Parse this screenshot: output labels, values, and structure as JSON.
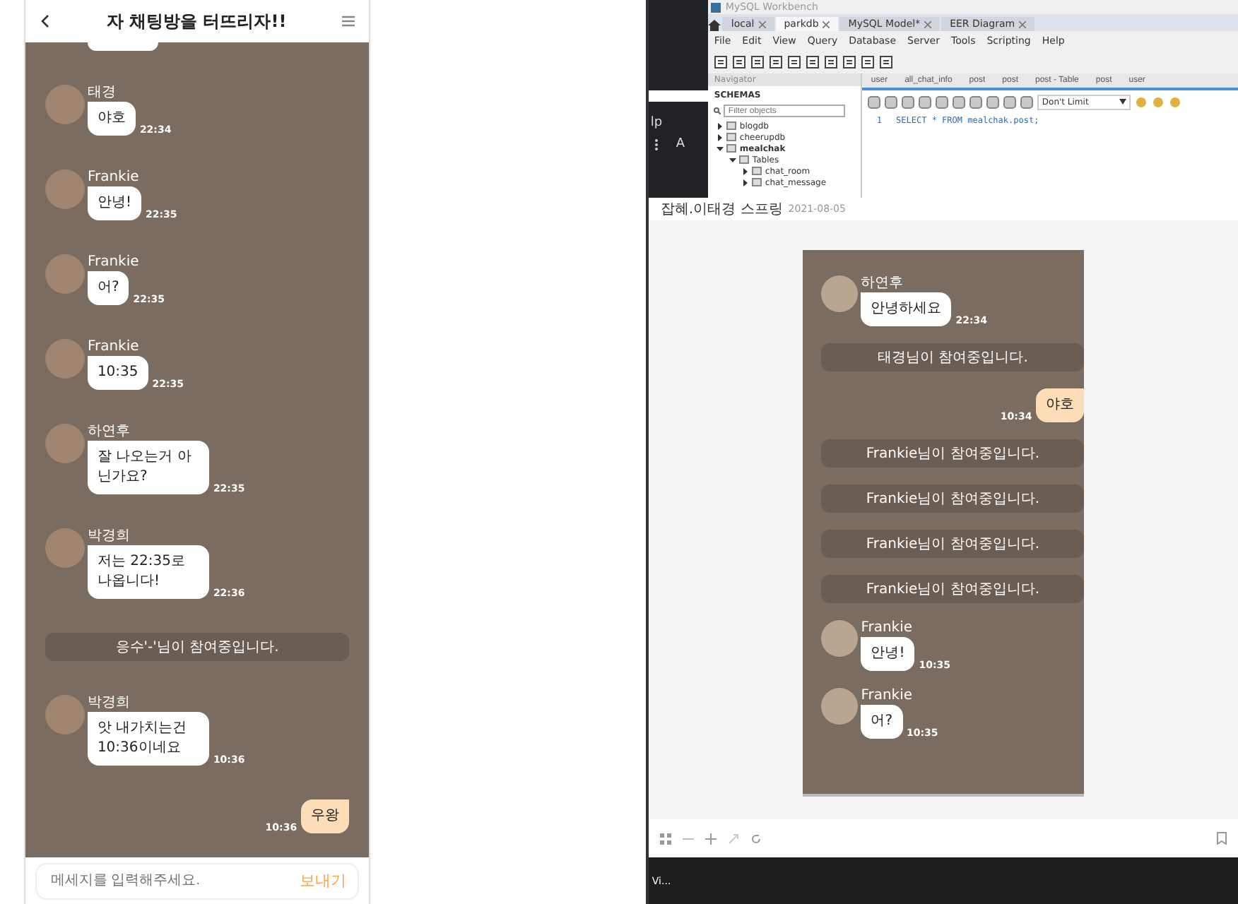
{
  "chat_app": {
    "title": "자 채팅방을 터뜨리자!!",
    "messages": [
      {
        "kind": "partial"
      },
      {
        "kind": "other",
        "sender": "태경",
        "text": "야호",
        "time": "22:34"
      },
      {
        "kind": "other",
        "sender": "Frankie",
        "text": "안녕!",
        "time": "22:35"
      },
      {
        "kind": "other",
        "sender": "Frankie",
        "text": "어?",
        "time": "22:35"
      },
      {
        "kind": "other",
        "sender": "Frankie",
        "text": "10:35",
        "time": "22:35"
      },
      {
        "kind": "other",
        "sender": "하연후",
        "text": "잘 나오는거 아닌가요?",
        "time": "22:35"
      },
      {
        "kind": "other",
        "sender": "박경희",
        "text": "저는 22:35로 나옵니다!",
        "time": "22:36"
      },
      {
        "kind": "notice",
        "text": "응수'-'님이 참여중입니다."
      },
      {
        "kind": "other",
        "sender": "박경희",
        "text": "앗 내가치는건 10:36이네요",
        "time": "10:36"
      },
      {
        "kind": "mine",
        "text": "우왕",
        "time": "10:36"
      }
    ],
    "input": {
      "placeholder": "메세지를 입력해주세요."
    },
    "send_button": "보내기"
  },
  "desktop": {
    "side_texts": [
      "lp",
      "A"
    ],
    "workbench": {
      "title": "MySQL Workbench",
      "tabs": [
        {
          "label": "local",
          "selected": false
        },
        {
          "label": "parkdb",
          "selected": true
        },
        {
          "label": "MySQL Model*",
          "selected": false
        },
        {
          "label": "EER Diagram",
          "selected": false
        }
      ],
      "menu": [
        "File",
        "Edit",
        "View",
        "Query",
        "Database",
        "Server",
        "Tools",
        "Scripting",
        "Help"
      ],
      "navigator": {
        "header": "Navigator",
        "schemas_label": "SCHEMAS",
        "filter_placeholder": "Filter objects",
        "tree": [
          {
            "label": "blogdb",
            "expanded": false,
            "default": false
          },
          {
            "label": "cheerupdb",
            "expanded": false,
            "default": false
          },
          {
            "label": "mealchak",
            "expanded": true,
            "default": true,
            "children": [
              {
                "label": "Tables",
                "expanded": true,
                "default": false,
                "children": [
                  {
                    "label": "chat_room",
                    "expanded": false,
                    "default": false
                  },
                  {
                    "label": "chat_message",
                    "expanded": false,
                    "default": false
                  }
                ]
              }
            ]
          }
        ]
      },
      "editor_tabs": [
        "user",
        "all_chat_info",
        "post",
        "post",
        "post - Table",
        "post",
        "user"
      ],
      "limit": "Don't Limit",
      "lines": [
        {
          "number": "1",
          "code": "SELECT * FROM mealchak.post;"
        }
      ]
    },
    "viewer": {
      "title": "잡혜.이태경 스프링",
      "date": "2021-08-05",
      "messages": [
        {
          "kind": "other",
          "sender": "하연후",
          "text": "안녕하세요",
          "time": "22:34"
        },
        {
          "kind": "notice",
          "text": "태경님이 참여중입니다."
        },
        {
          "kind": "mine",
          "text": "야호",
          "time": "10:34"
        },
        {
          "kind": "notice",
          "text": "Frankie님이 참여중입니다."
        },
        {
          "kind": "notice",
          "text": "Frankie님이 참여중입니다."
        },
        {
          "kind": "notice",
          "text": "Frankie님이 참여중입니다."
        },
        {
          "kind": "notice",
          "text": "Frankie님이 참여중입니다."
        },
        {
          "kind": "other",
          "sender": "Frankie",
          "text": "안녕!",
          "time": "10:35"
        },
        {
          "kind": "other",
          "sender": "Frankie",
          "text": "어?",
          "time": "10:35"
        }
      ]
    },
    "taskbar_text": "Vi..."
  }
}
